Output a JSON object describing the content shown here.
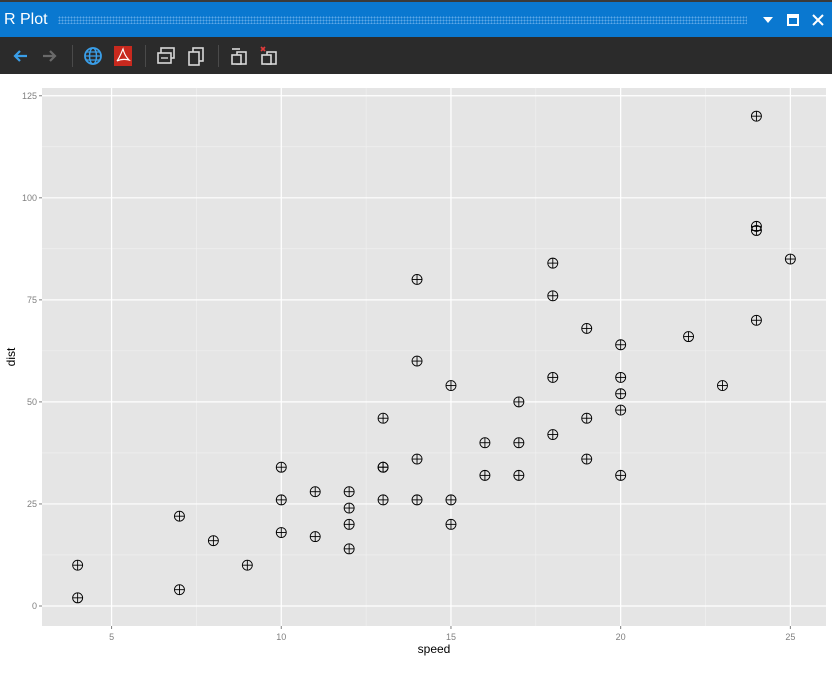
{
  "window": {
    "title": "R Plot",
    "title_bar_color": "#0a78d0",
    "toolbar_color": "#2b2b2b"
  },
  "title_controls": [
    {
      "name": "dropdown-icon"
    },
    {
      "name": "maximize-icon"
    },
    {
      "name": "close-icon"
    }
  ],
  "toolbar": [
    {
      "name": "back-arrow-icon",
      "enabled": true
    },
    {
      "name": "forward-arrow-icon",
      "enabled": false
    },
    {
      "name": "globe-icon",
      "enabled": true
    },
    {
      "name": "pdf-icon",
      "enabled": true
    },
    {
      "name": "copy-bitmap-icon",
      "enabled": true
    },
    {
      "name": "copy-metafile-icon",
      "enabled": true
    },
    {
      "name": "clear-plot-icon",
      "enabled": true
    },
    {
      "name": "remove-all-plots-icon",
      "enabled": true
    }
  ],
  "chart_data": {
    "type": "scatter",
    "title": "",
    "xlabel": "speed",
    "ylabel": "dist",
    "xlim": [
      2.95,
      26.05
    ],
    "ylim": [
      -4.9,
      126.9
    ],
    "xticks": [
      5,
      10,
      15,
      20,
      25
    ],
    "yticks": [
      0,
      25,
      50,
      75,
      100,
      125
    ],
    "grid": true,
    "panel_background": "#e5e5e5",
    "gridline_color": "#ffffff",
    "point_color": "#000000",
    "point_shape": "circle-plus",
    "points": [
      [
        4,
        2
      ],
      [
        4,
        10
      ],
      [
        7,
        4
      ],
      [
        7,
        22
      ],
      [
        8,
        16
      ],
      [
        9,
        10
      ],
      [
        10,
        18
      ],
      [
        10,
        26
      ],
      [
        10,
        34
      ],
      [
        11,
        17
      ],
      [
        11,
        28
      ],
      [
        12,
        14
      ],
      [
        12,
        20
      ],
      [
        12,
        24
      ],
      [
        12,
        28
      ],
      [
        13,
        26
      ],
      [
        13,
        34
      ],
      [
        13,
        34
      ],
      [
        13,
        46
      ],
      [
        14,
        26
      ],
      [
        14,
        36
      ],
      [
        14,
        60
      ],
      [
        14,
        80
      ],
      [
        15,
        20
      ],
      [
        15,
        26
      ],
      [
        15,
        54
      ],
      [
        16,
        32
      ],
      [
        16,
        40
      ],
      [
        17,
        32
      ],
      [
        17,
        40
      ],
      [
        17,
        50
      ],
      [
        18,
        42
      ],
      [
        18,
        56
      ],
      [
        18,
        76
      ],
      [
        18,
        84
      ],
      [
        19,
        36
      ],
      [
        19,
        46
      ],
      [
        19,
        68
      ],
      [
        20,
        32
      ],
      [
        20,
        48
      ],
      [
        20,
        52
      ],
      [
        20,
        56
      ],
      [
        20,
        64
      ],
      [
        22,
        66
      ],
      [
        23,
        54
      ],
      [
        24,
        70
      ],
      [
        24,
        92
      ],
      [
        24,
        93
      ],
      [
        24,
        120
      ],
      [
        25,
        85
      ]
    ]
  }
}
